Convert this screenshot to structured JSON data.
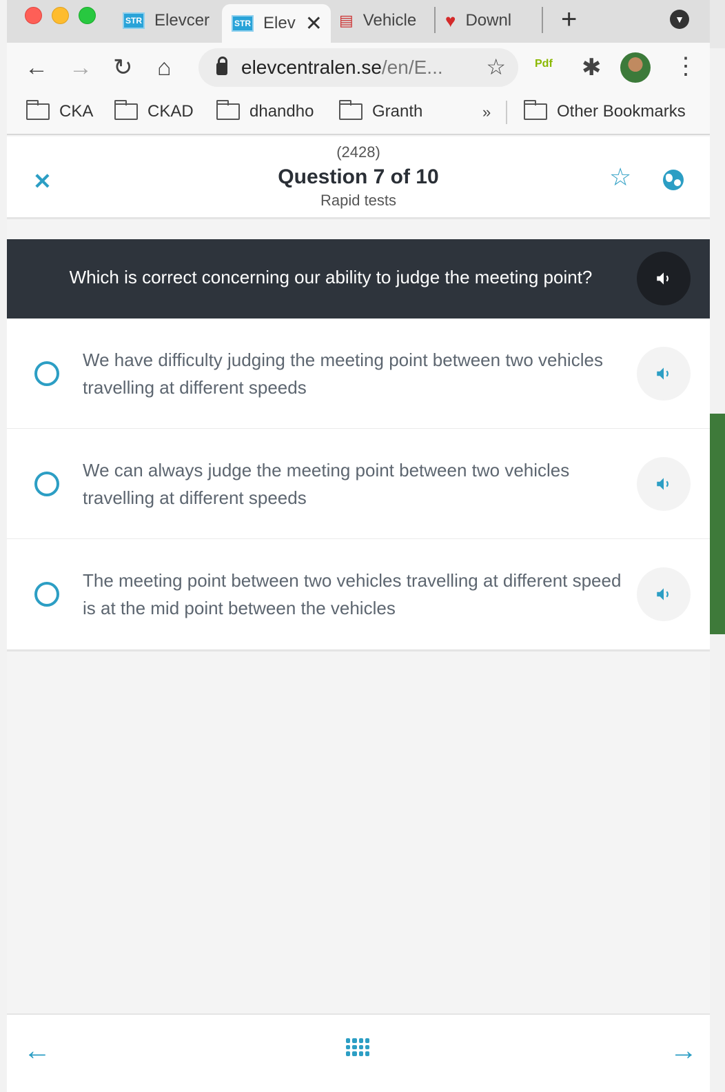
{
  "browser": {
    "tabs": [
      {
        "label": "Elevcer",
        "favicon": "STR"
      },
      {
        "label": "Elev",
        "favicon": "STR"
      },
      {
        "label": "Vehicle",
        "favicon": "license-icon"
      },
      {
        "label": "Downl",
        "favicon": "heart-icon"
      }
    ],
    "url_host": "elevcentralen.se",
    "url_path": "/en/E...",
    "bookmarks": [
      "CKA",
      "CKAD",
      "dhandho",
      "Granth"
    ],
    "bookmarks_more": "»",
    "other_bookmarks": "Other Bookmarks",
    "pdf_ext_label": "Pdf"
  },
  "header": {
    "question_id": "(2428)",
    "title": "Question 7 of 10",
    "subtitle": "Rapid tests"
  },
  "question": {
    "text": "Which is correct concerning our ability to judge the meeting point?"
  },
  "answers": [
    {
      "text": "We have difficulty judging the meeting point between two vehicles travelling at different speeds"
    },
    {
      "text": "We can always judge the meeting point between two vehicles travelling at different speeds"
    },
    {
      "text": "The meeting point between two vehicles travelling at different speed is at the mid point between the vehicles"
    }
  ],
  "colors": {
    "accent": "#2c9ec4",
    "question_bg": "#2e343c",
    "answer_text": "#5d6670"
  }
}
